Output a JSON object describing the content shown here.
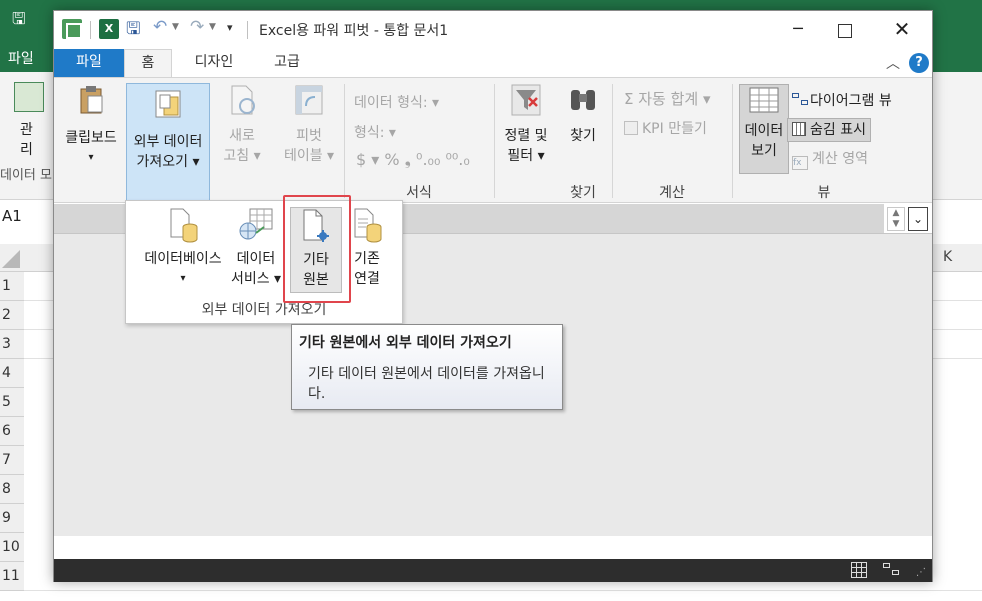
{
  "background_excel": {
    "file_tab": "파일",
    "power_pivot_label": "관리",
    "data_model_label": "데이터 모",
    "name_box": "A1",
    "column_k": "K",
    "rows": [
      "1",
      "2",
      "3",
      "4",
      "5",
      "6",
      "7",
      "8",
      "9",
      "10",
      "11"
    ]
  },
  "window": {
    "title": "Excel용 파워 피벗 - 통합 문서1"
  },
  "tabs": {
    "file": "파일",
    "home": "홈",
    "design": "디자인",
    "advanced": "고급"
  },
  "ribbon": {
    "clipboard": {
      "line1": "클립보드",
      "line2": "▾"
    },
    "get_external_data": {
      "line1": "외부 데이터",
      "line2": "가져오기 ▾"
    },
    "refresh": {
      "line1": "새로",
      "line2": "고침 ▾"
    },
    "pivot_table": {
      "line1": "피벗",
      "line2": "테이블 ▾"
    },
    "data_type": "데이터 형식: ▾",
    "format": "형식: ▾",
    "format_symbols": "$ ▾ % ❟ ⁰.₀₀ ⁰⁰.₀",
    "format_group": "서식",
    "sort_filter": {
      "line1": "정렬 및",
      "line2": "필터 ▾"
    },
    "find": "찾기",
    "find_group": "찾기",
    "autosum": "Σ 자동 합계 ▾",
    "create_kpi": "KPI 만들기",
    "calculation_group": "계산",
    "data_view": {
      "line1": "데이터",
      "line2": "보기"
    },
    "diagram_view": "다이어그램 뷰",
    "show_hidden": "숨김 표시",
    "calculation_area": "계산 영역",
    "view_group": "뷰"
  },
  "dropdown": {
    "database": {
      "line1": "데이터베이스",
      "line2": "▾"
    },
    "data_service": {
      "line1": "데이터",
      "line2": "서비스 ▾"
    },
    "other_sources": {
      "line1": "기타",
      "line2": "원본"
    },
    "existing_connections": {
      "line1": "기존",
      "line2": "연결"
    },
    "group_label": "외부 데이터 가져오기"
  },
  "tooltip": {
    "title": "기타 원본에서 외부 데이터 가져오기",
    "body": "기타 데이터 원본에서 데이터를 가져옵니다."
  },
  "colors": {
    "excel_green": "#217346",
    "accent_blue": "#1f7ac8",
    "highlight_red": "#e0454c"
  }
}
